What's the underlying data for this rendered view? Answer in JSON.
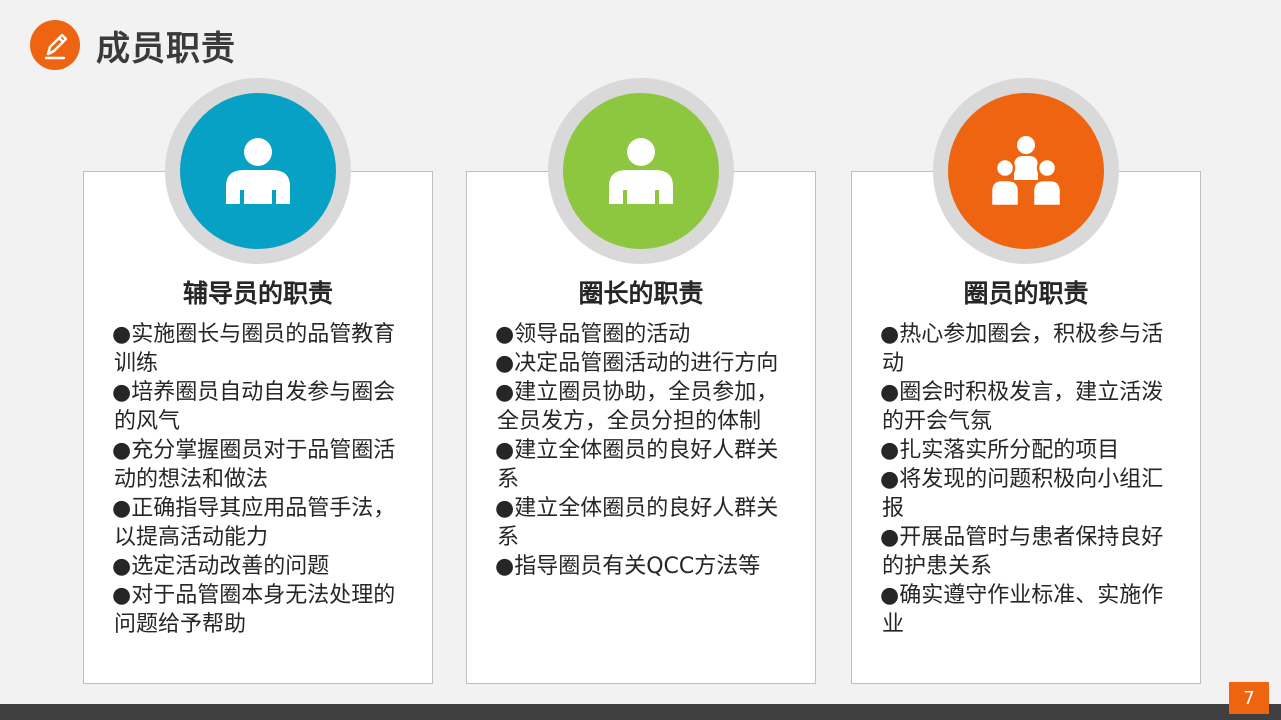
{
  "header": {
    "title": "成员职责",
    "icon": "pencil-icon"
  },
  "colors": {
    "accent": "#ee6411",
    "blue": "#06a1c4",
    "green": "#8dc63f",
    "orange": "#ee6411",
    "ring": "#d9d9d9"
  },
  "cards": [
    {
      "title": "辅导员的职责",
      "icon": "person-icon",
      "items": [
        "●实施圈长与圈员的品管教育训练",
        "●培养圈员自动自发参与圈会的风气",
        "●充分掌握圈员对于品管圈活动的想法和做法",
        "●正确指导其应用品管手法，以提高活动能力",
        "●选定活动改善的问题",
        "●对于品管圈本身无法处理的问题给予帮助"
      ]
    },
    {
      "title": "圈长的职责",
      "icon": "person-icon",
      "items": [
        "●领导品管圈的活动",
        "●决定品管圈活动的进行方向",
        "●建立圈员协助，全员参加，全员发方，全员分担的体制",
        "●建立全体圈员的良好人群关系",
        "●建立全体圈员的良好人群关系",
        "●指导圈员有关QCC方法等"
      ]
    },
    {
      "title": "圈员的职责",
      "icon": "group-icon",
      "items": [
        "●热心参加圈会，积极参与活动",
        "●圈会时积极发言，建立活泼的开会气氛",
        "●扎实落实所分配的项目",
        "●将发现的问题积极向小组汇报",
        "●开展品管时与患者保持良好的护患关系",
        "●确实遵守作业标准、实施作业"
      ]
    }
  ],
  "footer": {
    "page_number": "7"
  }
}
